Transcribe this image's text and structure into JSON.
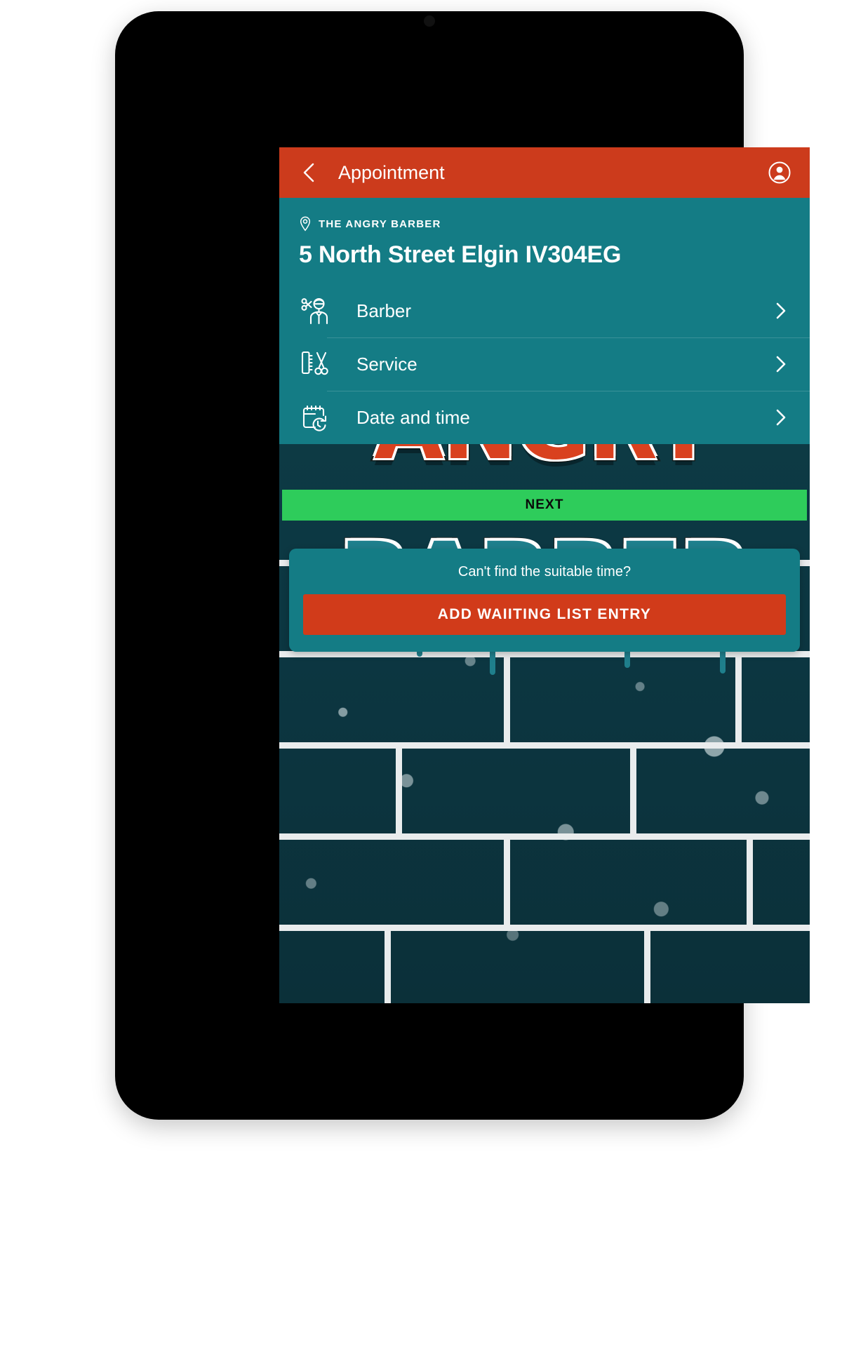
{
  "appbar": {
    "title": "Appointment",
    "back_icon": "chevron-left-icon",
    "account_icon": "account-circle-icon"
  },
  "venue": {
    "pin_icon": "location-pin-icon",
    "name": "THE ANGRY BARBER",
    "address": "5 North Street Elgin IV304EG"
  },
  "selection_rows": [
    {
      "label": "Barber",
      "icon": "barber-person-icon",
      "chevron": "chevron-right-icon"
    },
    {
      "label": "Service",
      "icon": "comb-scissors-icon",
      "chevron": "chevron-right-icon"
    },
    {
      "label": "Date and time",
      "icon": "calendar-clock-icon",
      "chevron": "chevron-right-icon"
    }
  ],
  "primary_action": {
    "label": "NEXT"
  },
  "waiting_list": {
    "prompt": "Can't find the suitable time?",
    "button_label": "ADD WAIITING LIST ENTRY"
  },
  "background": {
    "graffiti_top": "ANGRY",
    "graffiti_main": "BARBER"
  },
  "colors": {
    "appbar_red": "#cc3b1c",
    "panel_teal": "#147c85",
    "next_green": "#2ecc5b",
    "wait_button_red": "#d13b1a",
    "wall_dark_teal": "#0d3a43",
    "mortar_white": "#e9eced",
    "text_white": "#ffffff",
    "next_text_black": "#0a0a0a"
  }
}
